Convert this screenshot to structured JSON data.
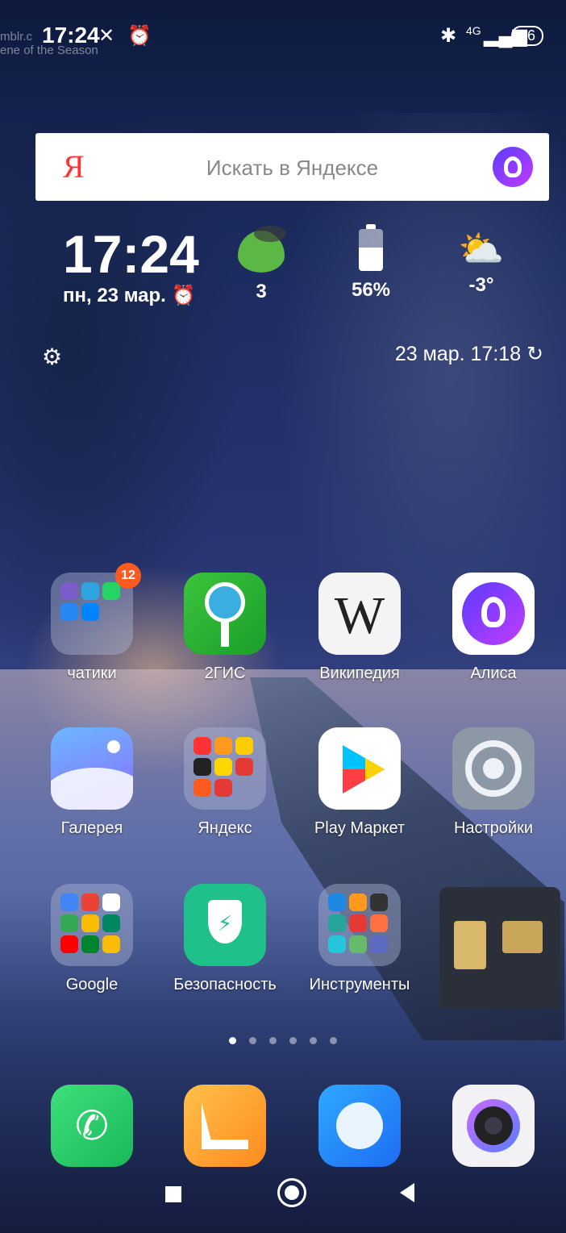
{
  "status_bar": {
    "watermark_line1": "mblr.c",
    "watermark_line2": "ene of the Season",
    "time": "17:24",
    "battery": "56",
    "network": "4G"
  },
  "search": {
    "logo": "Я",
    "placeholder": "Искать в Яндексе"
  },
  "widget": {
    "clock_time": "17:24",
    "clock_date": "пн, 23 мар.",
    "leaf_value": "3",
    "battery_value": "56%",
    "weather_value": "-3°",
    "updated": "23 мар. 17:18"
  },
  "apps": {
    "row1": [
      "чатики",
      "2ГИС",
      "Википедия",
      "Алиса"
    ],
    "row2": [
      "Галерея",
      "Яндекс",
      "Play Маркет",
      "Настройки"
    ],
    "row3": [
      "Google",
      "Безопасность",
      "Инструменты"
    ],
    "badge": "12"
  },
  "colors": {
    "accent_yandex": "#ff3333",
    "alice_purple": "#7a3cff",
    "badge": "#ff5a1f"
  }
}
